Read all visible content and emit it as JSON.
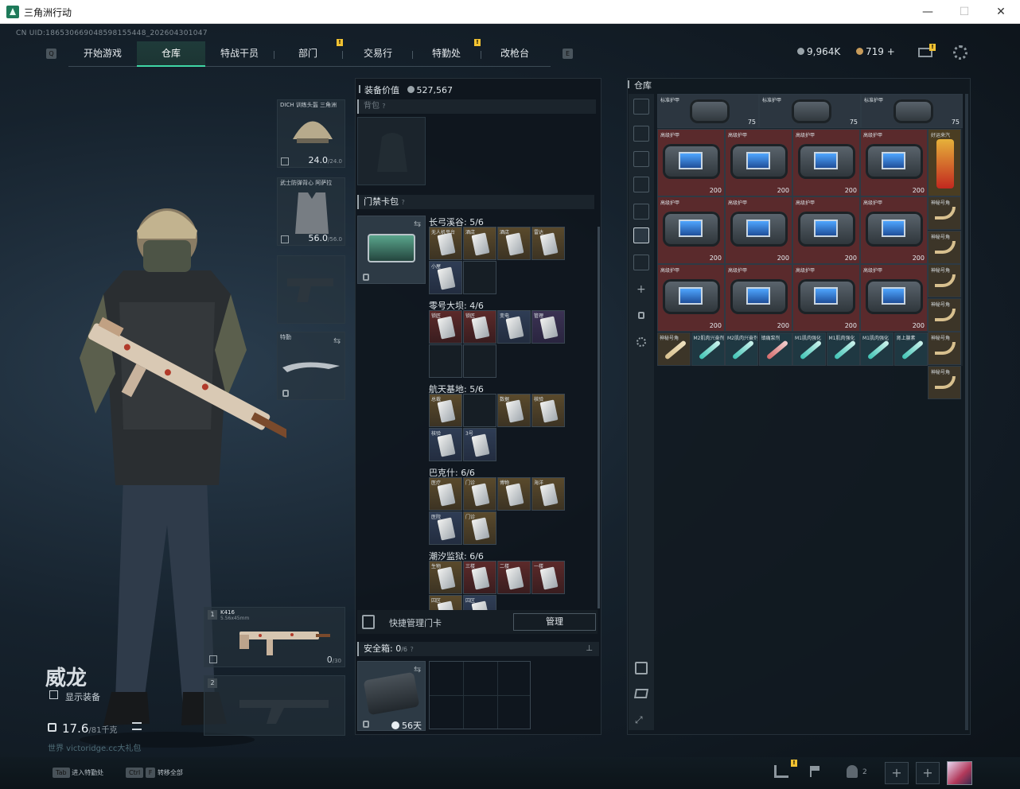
{
  "window": {
    "title": "三角洲行动",
    "min": "—",
    "max": "☐",
    "close": "✕"
  },
  "uid": "CN UID:18653066904859815544​8_202604301047",
  "nav": {
    "tabs": [
      "开始游戏",
      "仓库",
      "特战干员",
      "部门",
      "交易行",
      "特勤处",
      "改枪台"
    ],
    "active": "仓库",
    "left_key": "Q",
    "right_key": "E",
    "alerts": [
      "部门",
      "特勤处"
    ]
  },
  "currency": {
    "main": "9,964K",
    "secondary": "719",
    "plus": "+"
  },
  "character": {
    "name": "威龙",
    "show_equip": "显示装备",
    "weight": "17.6",
    "weight_max": "/81千克",
    "watermark": "世界 victoridge.cc大礼包"
  },
  "equipment": {
    "helmet": {
      "name": "DICH 训练头盔 三角洲",
      "durability": "24.0",
      "max": "/24.0"
    },
    "armor": {
      "name": "武士防弹背心 阿萨拉",
      "durability": "56.0",
      "max": "/56.0"
    },
    "melee": {
      "name": "特勤"
    },
    "primary": {
      "slot": "1",
      "name": "K416",
      "caliber": "5.56x45mm",
      "ammo": "0",
      "ammo_max": "/30"
    },
    "secondary": {
      "slot": "2"
    }
  },
  "mid": {
    "value_label": "装备价值",
    "value": "527,567",
    "backpack_label": "背包",
    "cardbag_label": "门禁卡包",
    "card_sets": [
      {
        "title": "长弓溪谷: 5/6",
        "cards": [
          {
            "l": "无人机平台",
            "c": "gold"
          },
          {
            "l": "酒店",
            "c": "gold"
          },
          {
            "l": "酒店",
            "c": "gold"
          },
          {
            "l": "雷达",
            "c": "gold"
          },
          {
            "l": "小屋",
            "c": "blue"
          },
          {
            "l": "",
            "c": "empty"
          }
        ]
      },
      {
        "title": "零号大坝: 4/6",
        "cards": [
          {
            "l": "锁匠",
            "c": "red"
          },
          {
            "l": "锁匠",
            "c": "red"
          },
          {
            "l": "变电",
            "c": "blue"
          },
          {
            "l": "管理",
            "c": "purple"
          },
          {
            "l": "",
            "c": "empty"
          },
          {
            "l": "",
            "c": "empty"
          }
        ]
      },
      {
        "title": "航天基地: 5/6",
        "cards": [
          {
            "l": "总裁",
            "c": "gold"
          },
          {
            "l": "",
            "c": "empty"
          },
          {
            "l": "数据",
            "c": "gold"
          },
          {
            "l": "核验",
            "c": "gold"
          },
          {
            "l": "核验",
            "c": "blue"
          },
          {
            "l": "3号",
            "c": "blue"
          }
        ]
      },
      {
        "title": "巴克什: 6/6",
        "cards": [
          {
            "l": "医疗",
            "c": "gold"
          },
          {
            "l": "门诊",
            "c": "gold"
          },
          {
            "l": "博物",
            "c": "gold"
          },
          {
            "l": "海洋",
            "c": "gold"
          },
          {
            "l": "医院",
            "c": "blue"
          },
          {
            "l": "门诊",
            "c": "gold"
          }
        ]
      },
      {
        "title": "潮汐监狱: 6/6",
        "cards": [
          {
            "l": "生物",
            "c": "gold"
          },
          {
            "l": "三楼",
            "c": "red"
          },
          {
            "l": "二楼",
            "c": "red"
          },
          {
            "l": "一楼",
            "c": "red"
          },
          {
            "l": "囚区",
            "c": "gold"
          },
          {
            "l": "囚区",
            "c": "blue"
          }
        ]
      }
    ],
    "quick_manage": "快捷管理门卡",
    "manage_btn": "管理",
    "safe_label": "安全箱:",
    "safe_count": "0",
    "safe_max": "/6",
    "safe_days": "56天"
  },
  "warehouse": {
    "title": "仓库",
    "row1": [
      {
        "l": "标准护甲",
        "n": "75"
      },
      {
        "l": "标准护甲",
        "n": "75"
      },
      {
        "l": "标准护甲",
        "n": "75"
      }
    ],
    "armor_label": "高级护甲",
    "armor_num": "200",
    "drink_label": "好运来汽",
    "horn_label": "神秘号角",
    "bottom_row": [
      {
        "l": "神秘号角"
      },
      {
        "l": "M2肌肉兴奋剂"
      },
      {
        "l": "M2肌肉兴奋剂"
      },
      {
        "l": "镇痛泵剂"
      },
      {
        "l": "M1肌肉强化"
      },
      {
        "l": "M1肌肉强化"
      },
      {
        "l": "M1肌肉强化"
      },
      {
        "l": "肾上腺素"
      }
    ]
  },
  "bottom": {
    "tab_key": "Tab",
    "tab_label": "进入特勤处",
    "ctrl_key": "Ctrl",
    "f_key": "F",
    "transfer_label": "转移全部",
    "party_count": "2"
  },
  "colors": {
    "accent": "#3fd6a5",
    "armor_bg": "#5a2a2c",
    "gold_card": "#5a4a2c"
  }
}
